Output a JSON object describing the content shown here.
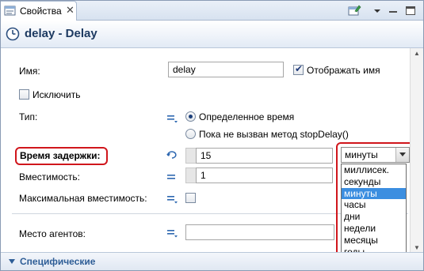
{
  "tab": {
    "label": "Свойства",
    "close": "✕"
  },
  "title": "delay - Delay",
  "fields": {
    "name_label": "Имя:",
    "name_value": "delay",
    "show_name_label": "Отображать имя",
    "show_name_checked": true,
    "exclude_label": "Исключить",
    "exclude_checked": false,
    "type_label": "Тип:",
    "type_options": [
      "Определенное время",
      "Пока не вызван метод stopDelay()"
    ],
    "type_selected": 0,
    "delay_label": "Время задержки:",
    "delay_value": "15",
    "capacity_label": "Вместимость:",
    "capacity_value": "1",
    "max_capacity_label": "Максимальная вместимость:",
    "max_capacity_checked": false,
    "agent_location_label": "Место агентов:",
    "agent_location_value": ""
  },
  "units": {
    "selected": "минуты",
    "options": [
      "миллисек.",
      "секунды",
      "минуты",
      "часы",
      "дни",
      "недели",
      "месяцы",
      "годы"
    ],
    "selected_index": 2
  },
  "section": {
    "label": "Специфические"
  },
  "colors": {
    "highlight": "#d0161c",
    "selection": "#3b8ee0",
    "section_text": "#2e5d96"
  }
}
